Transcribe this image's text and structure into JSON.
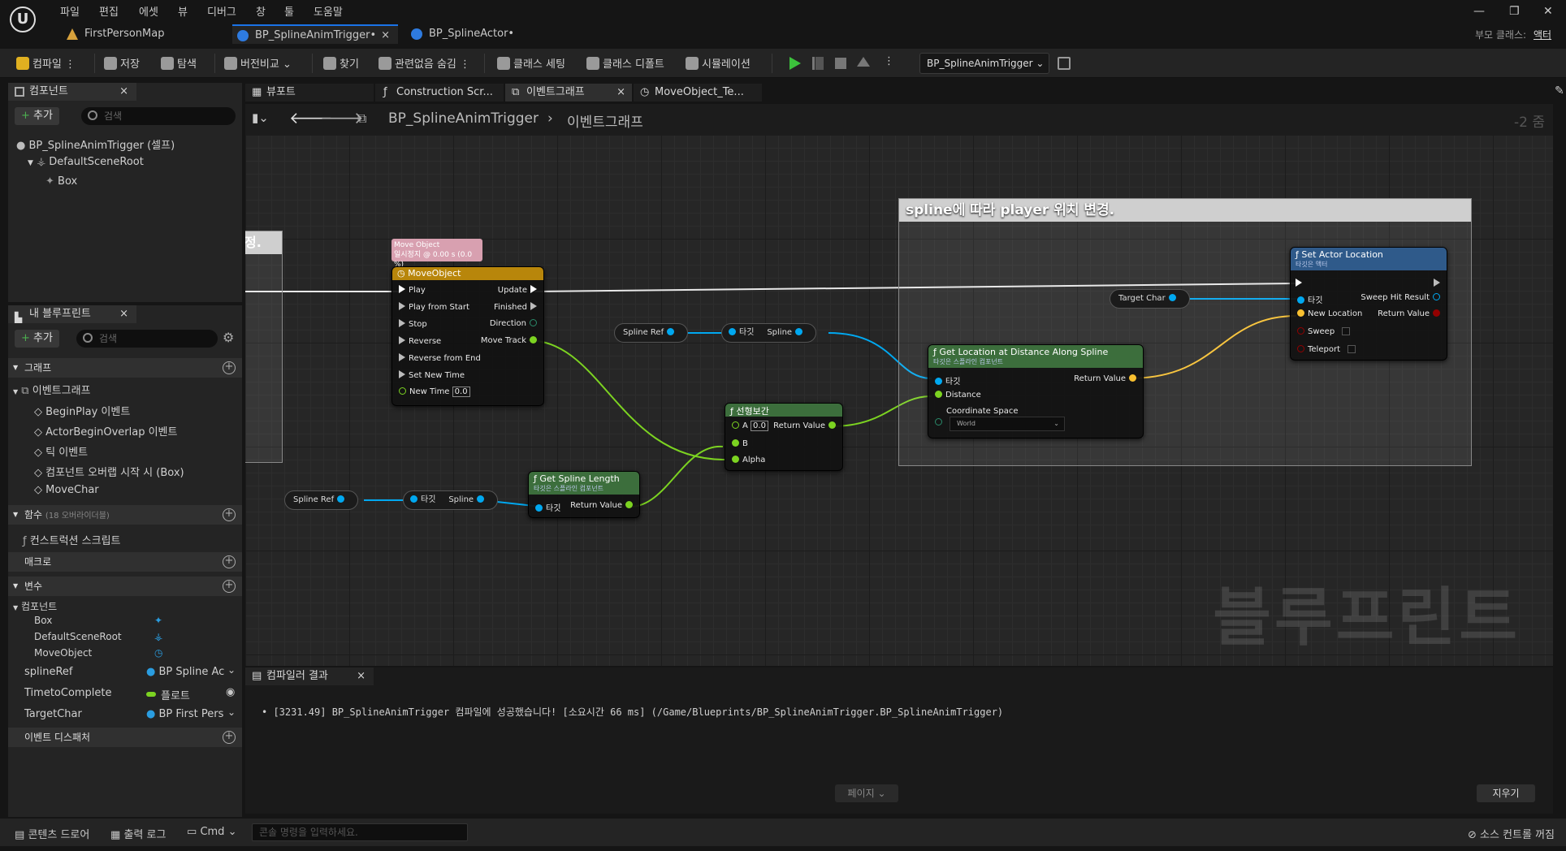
{
  "menu": [
    "파일",
    "편집",
    "에셋",
    "뷰",
    "디버그",
    "창",
    "툴",
    "도움말"
  ],
  "tabs": [
    {
      "label": "FirstPersonMap"
    },
    {
      "label": "BP_SplineAnimTrigger•"
    },
    {
      "label": "BP_SplineActor•"
    }
  ],
  "parent_class": {
    "label": "부모 클래스:",
    "value": "액터"
  },
  "toolbar": {
    "compile": "컴파일",
    "save": "저장",
    "browse": "탐색",
    "diff": "버전비교",
    "find": "찾기",
    "hide_unrelated": "관련없음 숨김",
    "class_settings": "클래스 세팅",
    "class_defaults": "클래스 디폴트",
    "simulation": "시뮬레이션",
    "debug_object": "BP_SplineAnimTrigger"
  },
  "components_panel": {
    "tab": "컴포넌트",
    "add": "추가",
    "search_placeholder": "검색",
    "items": [
      "BP_SplineAnimTrigger (셀프)",
      "DefaultSceneRoot",
      "Box"
    ]
  },
  "my_blueprint": {
    "tab": "내 블루프린트",
    "add": "추가",
    "search_placeholder": "검색",
    "graph_section": "그래프",
    "event_graph": "이벤트그래프",
    "events": [
      "BeginPlay 이벤트",
      "ActorBeginOverlap 이벤트",
      "틱 이벤트",
      "컴포넌트 오버랩 시작 시 (Box)",
      "MoveChar"
    ],
    "functions_section": "함수",
    "functions_override": "(18 오버라이더블)",
    "construction_script": "컨스트럭션 스크립트",
    "macros_section": "매크로",
    "variables_section": "변수",
    "components_group": "컴포넌트",
    "component_vars": [
      "Box",
      "DefaultSceneRoot",
      "MoveObject"
    ],
    "variables": [
      {
        "name": "splineRef",
        "type": "BP Spline Ac"
      },
      {
        "name": "TimetoComplete",
        "type": "플로트"
      },
      {
        "name": "TargetChar",
        "type": "BP First Pers"
      }
    ],
    "event_dispatchers": "이벤트 디스패처"
  },
  "editor_tabs": [
    "뷰포트",
    "Construction Scr...",
    "이벤트그래프",
    "MoveObject_Te..."
  ],
  "breadcrumb": {
    "root": "BP_SplineAnimTrigger",
    "current": "이벤트그래프",
    "zoom": "-2 줌"
  },
  "graph": {
    "comment_title": "spline에 따라 player 위치 변경.",
    "left_comment_fragment": "정.",
    "watermark": "블루프린트",
    "timeline_comment": {
      "line1": "Move Object",
      "line2": "일시정지 @ 0.00 s (0.0 %)"
    },
    "timeline": {
      "title": "MoveObject",
      "inputs": [
        "Play",
        "Play from Start",
        "Stop",
        "Reverse",
        "Reverse from End",
        "Set New Time",
        "New Time"
      ],
      "new_time_value": "0.0",
      "outputs": [
        "Update",
        "Finished",
        "Direction",
        "Move Track"
      ]
    },
    "spline_ref_1": "Spline Ref",
    "target_1": "타깃",
    "spline_1": "Spline",
    "spline_ref_2": "Spline Ref",
    "target_2": "타깃",
    "spline_2": "Spline",
    "get_length": {
      "title": "Get Spline Length",
      "subtitle": "타깃은 스플라인 컴포넌트",
      "target": "타깃",
      "ret": "Return Value"
    },
    "lerp": {
      "title": "선형보간",
      "a": "A",
      "a_value": "0.0",
      "b": "B",
      "alpha": "Alpha",
      "ret": "Return Value"
    },
    "get_location": {
      "title": "Get Location at Distance Along Spline",
      "subtitle": "타깃은 스플라인 컴포넌트",
      "target": "타깃",
      "distance": "Distance",
      "coord": "Coordinate Space",
      "coord_value": "World",
      "ret": "Return Value"
    },
    "target_char": "Target Char",
    "set_location": {
      "title": "Set Actor Location",
      "subtitle": "타깃은 액터",
      "target": "타깃",
      "new_location": "New Location",
      "sweep": "Sweep",
      "teleport": "Teleport",
      "sweep_hit": "Sweep Hit Result",
      "ret": "Return Value"
    }
  },
  "compiler": {
    "tab": "컴파일러 결과",
    "message": "[3231.49] BP_SplineAnimTrigger 컴파일에 성공했습니다! [소요시간 66 ms] (/Game/Blueprints/BP_SplineAnimTrigger.BP_SplineAnimTrigger)",
    "page": "페이지",
    "clear": "지우기"
  },
  "statusbar": {
    "content_drawer": "콘텐츠 드로어",
    "output_log": "출력 로그",
    "cmd": "Cmd",
    "console_placeholder": "콘솔 명령을 입력하세요.",
    "source_control": "소스 컨트롤 꺼짐"
  },
  "colors": {
    "accent": "#1a73e8",
    "exec": "#ffffff",
    "float_pin": "#7cd321",
    "object_pin": "#00a8f0",
    "vector_pin": "#f8c030",
    "bool_pin": "#930000"
  }
}
